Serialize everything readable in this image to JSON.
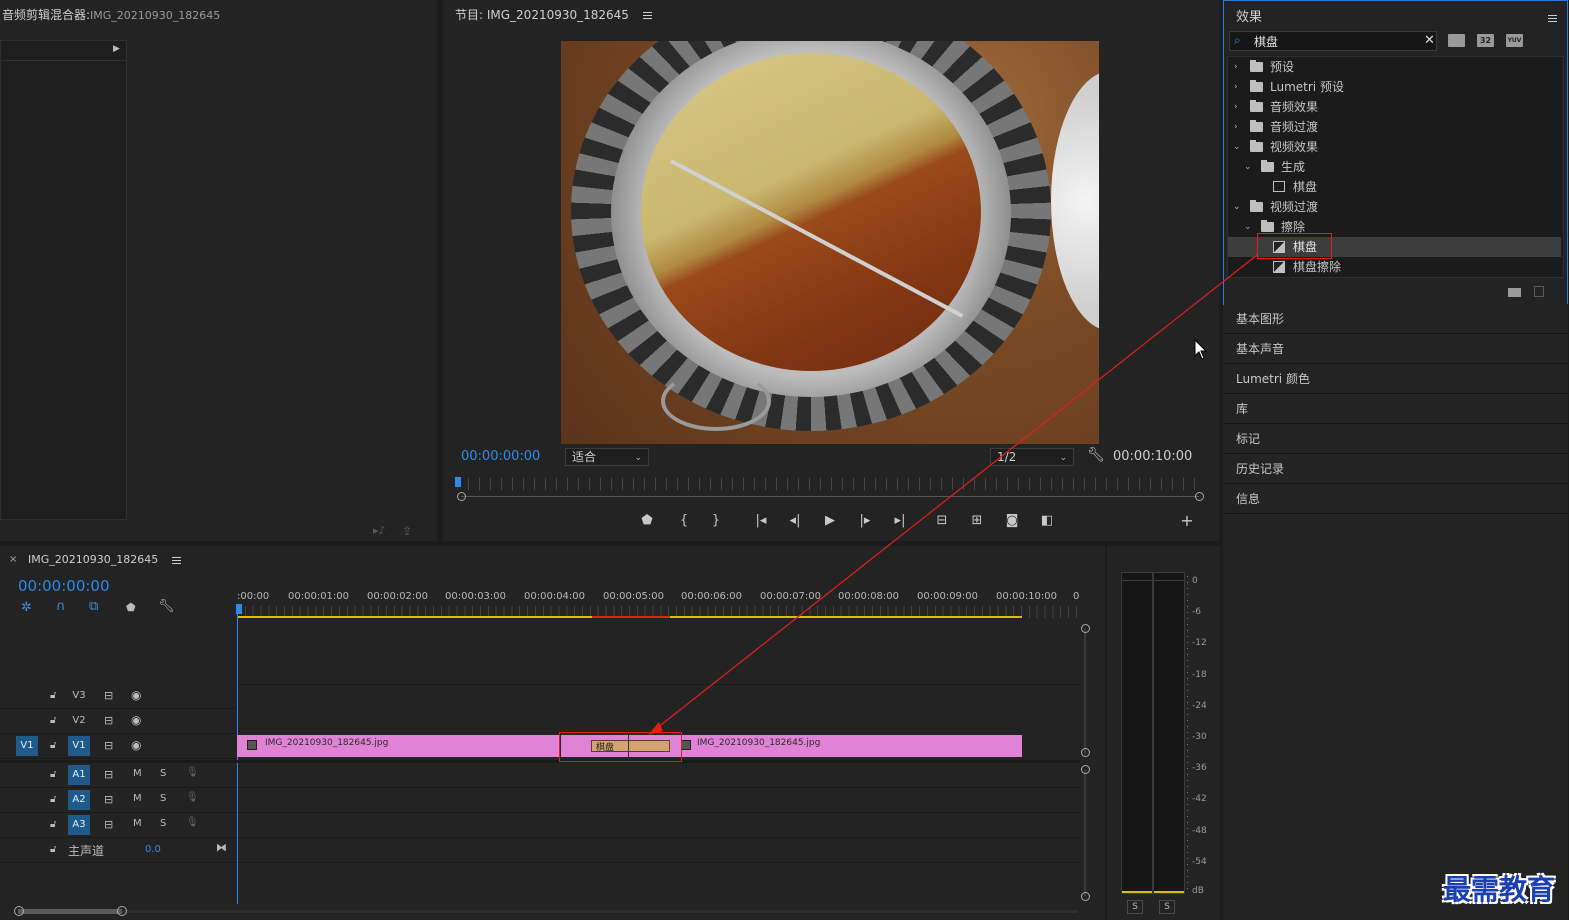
{
  "source_panel": {
    "title_prefix": "音频剪辑混合器:",
    "title_clip": "IMG_20210930_182645"
  },
  "program_monitor": {
    "title": "节目: IMG_20210930_182645",
    "timecode_current": "00:00:00:00",
    "fit_dropdown": "适合",
    "resolution_dropdown": "1/2",
    "timecode_duration": "00:00:10:00"
  },
  "effects_panel": {
    "title": "效果",
    "search_value": "棋盘",
    "badge_32": "32",
    "badge_yuv": "YUV",
    "tree": [
      {
        "label": "预设",
        "level": 0,
        "expanded": false,
        "icon": "folder-preset"
      },
      {
        "label": "Lumetri 预设",
        "level": 0,
        "expanded": false,
        "icon": "folder-preset"
      },
      {
        "label": "音频效果",
        "level": 0,
        "expanded": false,
        "icon": "folder"
      },
      {
        "label": "音频过渡",
        "level": 0,
        "expanded": false,
        "icon": "folder"
      },
      {
        "label": "视频效果",
        "level": 0,
        "expanded": true,
        "icon": "folder"
      },
      {
        "label": "生成",
        "level": 1,
        "expanded": true,
        "icon": "folder"
      },
      {
        "label": "棋盘",
        "level": 2,
        "icon": "effect"
      },
      {
        "label": "视频过渡",
        "level": 0,
        "expanded": true,
        "icon": "folder"
      },
      {
        "label": "擦除",
        "level": 1,
        "expanded": true,
        "icon": "folder"
      },
      {
        "label": "棋盘",
        "level": 2,
        "icon": "transition",
        "selected": true
      },
      {
        "label": "棋盘擦除",
        "level": 2,
        "icon": "transition"
      }
    ]
  },
  "side_panels": [
    "基本图形",
    "基本声音",
    "Lumetri 颜色",
    "库",
    "标记",
    "历史记录",
    "信息"
  ],
  "timeline": {
    "sequence_name": "IMG_20210930_182645",
    "timecode": "00:00:00:00",
    "ruler_labels": [
      ":00:00",
      "00:00:01:00",
      "00:00:02:00",
      "00:00:03:00",
      "00:00:04:00",
      "00:00:05:00",
      "00:00:06:00",
      "00:00:07:00",
      "00:00:08:00",
      "00:00:09:00",
      "00:00:10:00",
      "0"
    ],
    "tracks": {
      "v3": "V3",
      "v2": "V2",
      "v1": "V1",
      "v1_source": "V1",
      "a1": "A1",
      "a2": "A2",
      "a3": "A3",
      "mute": "M",
      "solo": "S",
      "master": "主声道",
      "master_value": "0.0"
    },
    "clip_left": "IMG_20210930_182645.jpg",
    "clip_right": "IMG_20210930_182645.jpg",
    "transition_label": "棋盘"
  },
  "audio_meter": {
    "scale": [
      "0",
      "-6",
      "-12",
      "-18",
      "-24",
      "-30",
      "-36",
      "-42",
      "-48",
      "-54",
      "dB"
    ],
    "solo_left": "S",
    "solo_right": "S"
  },
  "watermark": "最需教育",
  "colors": {
    "accent_blue": "#2d8ceb",
    "clip_pink": "#e083d6",
    "annotation_red": "#e01e1e",
    "work_area_yellow": "#d6c200"
  }
}
